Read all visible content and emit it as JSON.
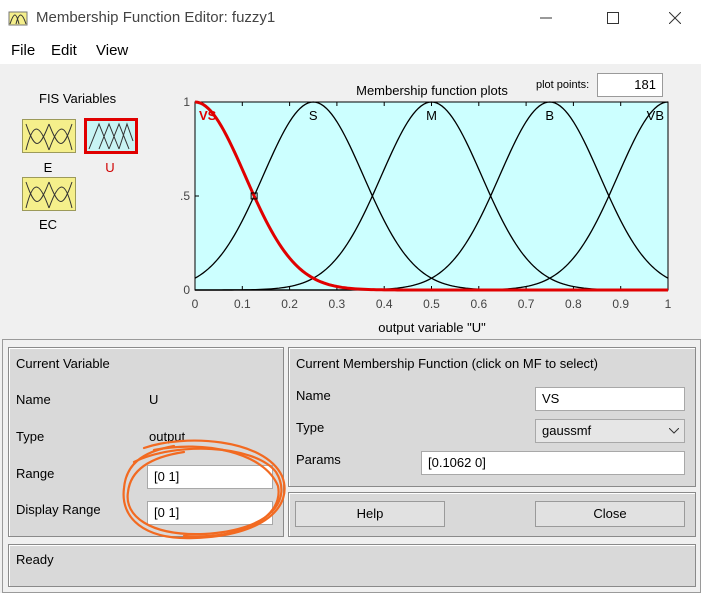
{
  "window": {
    "title": "Membership Function Editor: fuzzy1",
    "minimize_icon": "minimize-icon",
    "maximize_icon": "maximize-icon",
    "close_icon": "close-icon"
  },
  "menu": {
    "items": [
      "File",
      "Edit",
      "View"
    ]
  },
  "fis_variables": {
    "title": "FIS Variables",
    "vars": [
      {
        "label": "E",
        "selected": false
      },
      {
        "label": "U",
        "selected": true
      },
      {
        "label": "EC",
        "selected": false
      }
    ]
  },
  "plot": {
    "title": "Membership function plots",
    "plot_points_label": "plot points:",
    "plot_points_value": "181",
    "background_color": "#ccffff",
    "highlight_color": "#e00000",
    "mf_labels": [
      "VS",
      "S",
      "M",
      "B",
      "VB"
    ]
  },
  "chart_data": {
    "type": "line",
    "title": "Membership function plots",
    "xlabel": "output variable \"U\"",
    "ylabel": "",
    "xlim": [
      0,
      1
    ],
    "ylim": [
      0,
      1
    ],
    "x_ticks": [
      "0",
      "0.1",
      "0.2",
      "0.3",
      "0.4",
      "0.5",
      "0.6",
      "0.7",
      "0.8",
      "0.9",
      "1"
    ],
    "y_ticks": [
      "0",
      "0.5",
      "1"
    ],
    "series": [
      {
        "name": "VS",
        "function": "gaussmf",
        "sigma": 0.1062,
        "center": 0.0,
        "selected": true
      },
      {
        "name": "S",
        "function": "gaussmf",
        "sigma": 0.1062,
        "center": 0.25,
        "selected": false
      },
      {
        "name": "M",
        "function": "gaussmf",
        "sigma": 0.1062,
        "center": 0.5,
        "selected": false
      },
      {
        "name": "B",
        "function": "gaussmf",
        "sigma": 0.1062,
        "center": 0.75,
        "selected": false
      },
      {
        "name": "VB",
        "function": "gaussmf",
        "sigma": 0.1062,
        "center": 1.0,
        "selected": false
      }
    ]
  },
  "current_variable": {
    "title": "Current Variable",
    "name_label": "Name",
    "name_value": "U",
    "type_label": "Type",
    "type_value": "output",
    "range_label": "Range",
    "range_value": "[0 1]",
    "display_range_label": "Display Range",
    "display_range_value": "[0 1]"
  },
  "current_mf": {
    "title": "Current Membership Function (click on MF to select)",
    "name_label": "Name",
    "name_value": "VS",
    "type_label": "Type",
    "type_value": "gaussmf",
    "params_label": "Params",
    "params_value": "[0.1062 0]"
  },
  "buttons": {
    "help": "Help",
    "close": "Close"
  },
  "status": {
    "text": "Ready"
  },
  "annotation_color": "#f26a21"
}
